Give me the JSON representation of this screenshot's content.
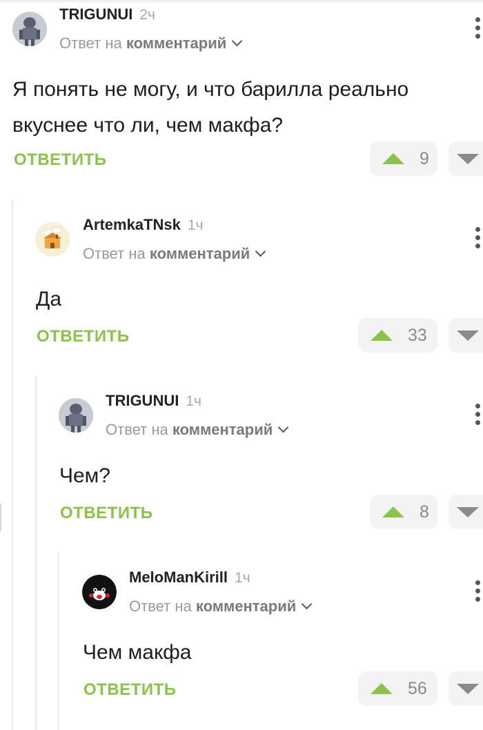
{
  "comments": [
    {
      "author": "TRIGUNUI",
      "time": "2ч",
      "reply_prefix": "Ответ на",
      "reply_target": "комментарий",
      "text_lines": [
        "Я понять не могу, и что барилла реально",
        "вкуснее что ли, чем макфа?"
      ],
      "reply_label": "ОТВЕТИТЬ",
      "votes": "9",
      "avatar_icon": "robot-avatar-icon"
    },
    {
      "author": "ArtemkaTNsk",
      "time": "1ч",
      "reply_prefix": "Ответ на",
      "reply_target": "комментарий",
      "text_lines": [
        "Да"
      ],
      "reply_label": "ОТВЕТИТЬ",
      "votes": "33",
      "avatar_icon": "house-avatar-icon"
    },
    {
      "author": "TRIGUNUI",
      "time": "1ч",
      "reply_prefix": "Ответ на",
      "reply_target": "комментарий",
      "text_lines": [
        "Чем?"
      ],
      "reply_label": "ОТВЕТИТЬ",
      "votes": "8",
      "avatar_icon": "robot-avatar-icon"
    },
    {
      "author": "MeloManKirill",
      "time": "1ч",
      "reply_prefix": "Ответ на",
      "reply_target": "комментарий",
      "text_lines": [
        "Чем макфа"
      ],
      "reply_label": "ОТВЕТИТЬ",
      "votes": "56",
      "avatar_icon": "bear-avatar-icon"
    }
  ],
  "colors": {
    "accent_green": "#8bc34a",
    "vote_bg": "#f3f3f3",
    "thread_line": "#e9e9e9"
  }
}
